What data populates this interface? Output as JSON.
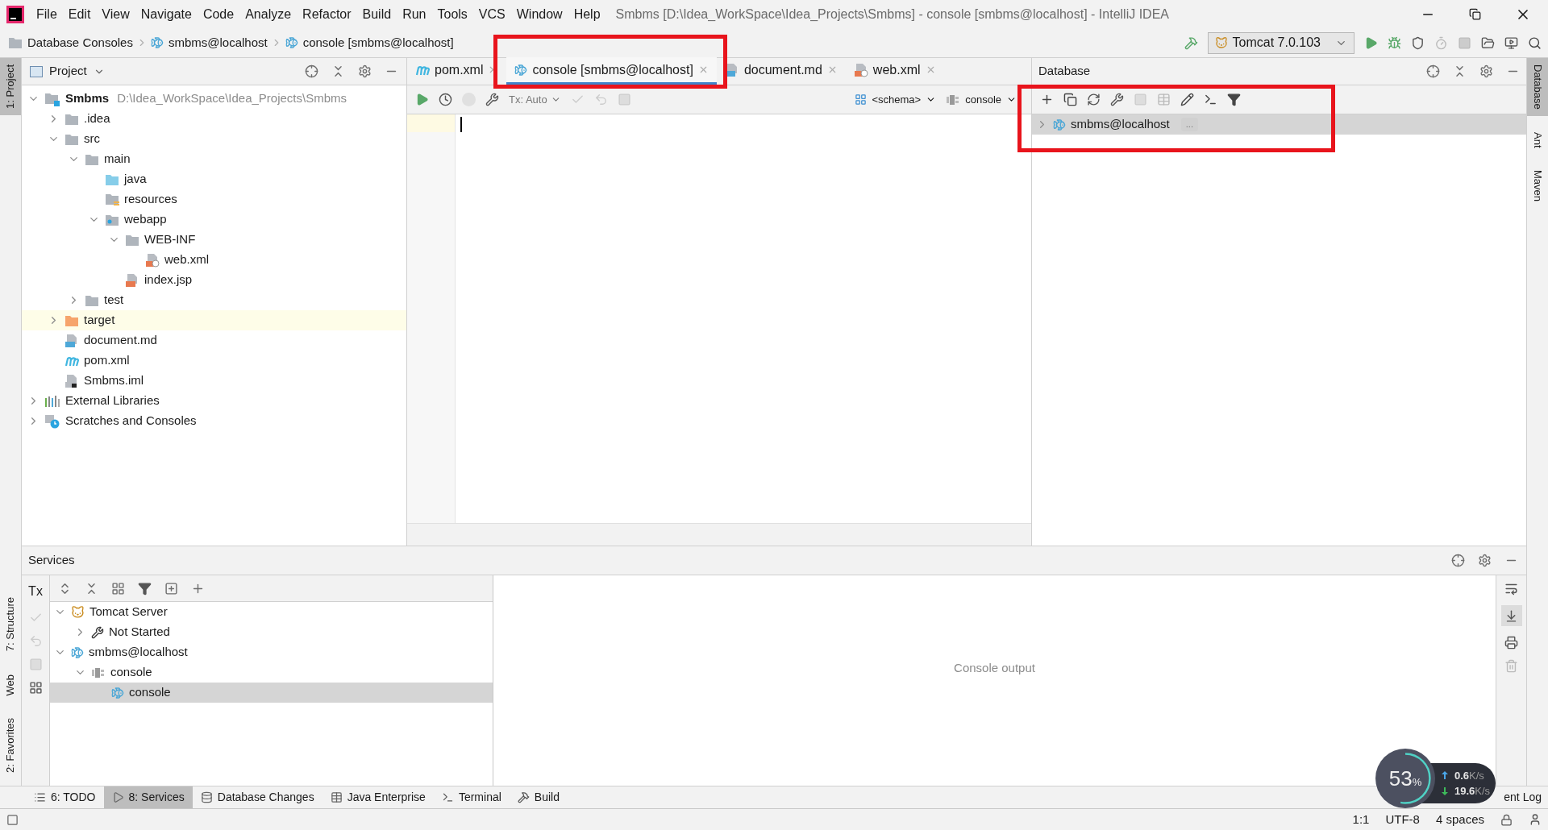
{
  "menu": [
    "File",
    "Edit",
    "View",
    "Navigate",
    "Code",
    "Analyze",
    "Refactor",
    "Build",
    "Run",
    "Tools",
    "VCS",
    "Window",
    "Help"
  ],
  "window_title": "Smbms [D:\\Idea_WorkSpace\\Idea_Projects\\Smbms] - console [smbms@localhost] - IntelliJ IDEA",
  "breadcrumbs": [
    {
      "label": "Database Consoles",
      "kind": "folder"
    },
    {
      "label": "smbms@localhost",
      "kind": "database"
    },
    {
      "label": "console [smbms@localhost]",
      "kind": "database"
    }
  ],
  "run_config": "Tomcat 7.0.103",
  "left_stripe_top": [
    {
      "label": "1: Project",
      "selected": true
    }
  ],
  "left_stripe_bottom": [
    {
      "label": "7: Structure",
      "selected": false
    },
    {
      "label": "Web",
      "selected": false
    },
    {
      "label": "2: Favorites",
      "selected": false
    }
  ],
  "right_stripe": [
    {
      "label": "Database",
      "selected": true
    },
    {
      "label": "Ant",
      "selected": false
    },
    {
      "label": "Maven",
      "selected": false
    }
  ],
  "project": {
    "title": "Project",
    "tree": [
      {
        "label": "Smbms",
        "path": "D:\\Idea_WorkSpace\\Idea_Projects\\Smbms",
        "kind": "module",
        "expanded": true,
        "selected": false,
        "children": [
          {
            "label": ".idea",
            "kind": "folder",
            "expanded": false,
            "selected": false
          },
          {
            "label": "src",
            "kind": "folder",
            "expanded": true,
            "selected": false,
            "children": [
              {
                "label": "main",
                "kind": "folder",
                "expanded": true,
                "selected": false,
                "children": [
                  {
                    "label": "java",
                    "kind": "source-folder",
                    "selected": false
                  },
                  {
                    "label": "resources",
                    "kind": "resource-folder",
                    "selected": false
                  },
                  {
                    "label": "webapp",
                    "kind": "web-folder",
                    "expanded": true,
                    "selected": false,
                    "children": [
                      {
                        "label": "WEB-INF",
                        "kind": "folder",
                        "expanded": true,
                        "selected": false,
                        "children": [
                          {
                            "label": "web.xml",
                            "kind": "xml",
                            "selected": false
                          }
                        ]
                      },
                      {
                        "label": "index.jsp",
                        "kind": "jsp",
                        "selected": false
                      }
                    ]
                  }
                ]
              },
              {
                "label": "test",
                "kind": "folder",
                "expanded": false,
                "selected": false
              }
            ]
          },
          {
            "label": "target",
            "kind": "excluded-folder",
            "expanded": false,
            "selected": true
          },
          {
            "label": "document.md",
            "kind": "md",
            "selected": false
          },
          {
            "label": "pom.xml",
            "kind": "maven",
            "selected": false
          },
          {
            "label": "Smbms.iml",
            "kind": "iml",
            "selected": false
          }
        ]
      },
      {
        "label": "External Libraries",
        "kind": "libraries",
        "expanded": false,
        "selected": false
      },
      {
        "label": "Scratches and Consoles",
        "kind": "scratches",
        "expanded": false,
        "selected": false
      }
    ]
  },
  "editor": {
    "tabs": [
      {
        "label": "pom.xml",
        "kind": "maven",
        "selected": false
      },
      {
        "label": "console [smbms@localhost]",
        "kind": "database",
        "selected": true
      },
      {
        "label": "document.md",
        "kind": "md",
        "selected": false
      },
      {
        "label": "web.xml",
        "kind": "xml",
        "selected": false
      }
    ],
    "tx_mode": "Tx: Auto",
    "schema": "<schema>",
    "session": "console"
  },
  "database": {
    "title": "Database",
    "tree": [
      {
        "label": "smbms@localhost",
        "badge": "...",
        "kind": "database",
        "expanded": false,
        "selected": true
      }
    ]
  },
  "services": {
    "title": "Services",
    "tx": "Tx",
    "tree": [
      {
        "label": "Tomcat Server",
        "kind": "tomcat",
        "expanded": true,
        "selected": false,
        "children": [
          {
            "label": "Not Started",
            "kind": "wrench",
            "expanded": false,
            "selected": false
          }
        ]
      },
      {
        "label": "smbms@localhost",
        "kind": "database",
        "expanded": true,
        "selected": false,
        "children": [
          {
            "label": "console",
            "kind": "session",
            "expanded": true,
            "selected": false,
            "children": [
              {
                "label": "console",
                "kind": "database",
                "selected": true
              }
            ]
          }
        ]
      }
    ],
    "output_placeholder": "Console output"
  },
  "bottom_tabs": [
    {
      "label": "6: TODO",
      "kind": "list",
      "selected": false
    },
    {
      "label": "8: Services",
      "kind": "services",
      "selected": true
    },
    {
      "label": "Database Changes",
      "kind": "dbchanges",
      "selected": false
    },
    {
      "label": "Java Enterprise",
      "kind": "javaee",
      "selected": false
    },
    {
      "label": "Terminal",
      "kind": "terminal",
      "selected": false
    },
    {
      "label": "Build",
      "kind": "hammer",
      "selected": false
    }
  ],
  "event_log": "ent Log",
  "status": [
    "1:1",
    "UTF-8",
    "4 spaces"
  ],
  "net_widget": {
    "cpu": "53",
    "cpu_unit": "%",
    "up": "0.6",
    "up_unit": "K/s",
    "down": "19.6",
    "down_unit": "K/s"
  }
}
